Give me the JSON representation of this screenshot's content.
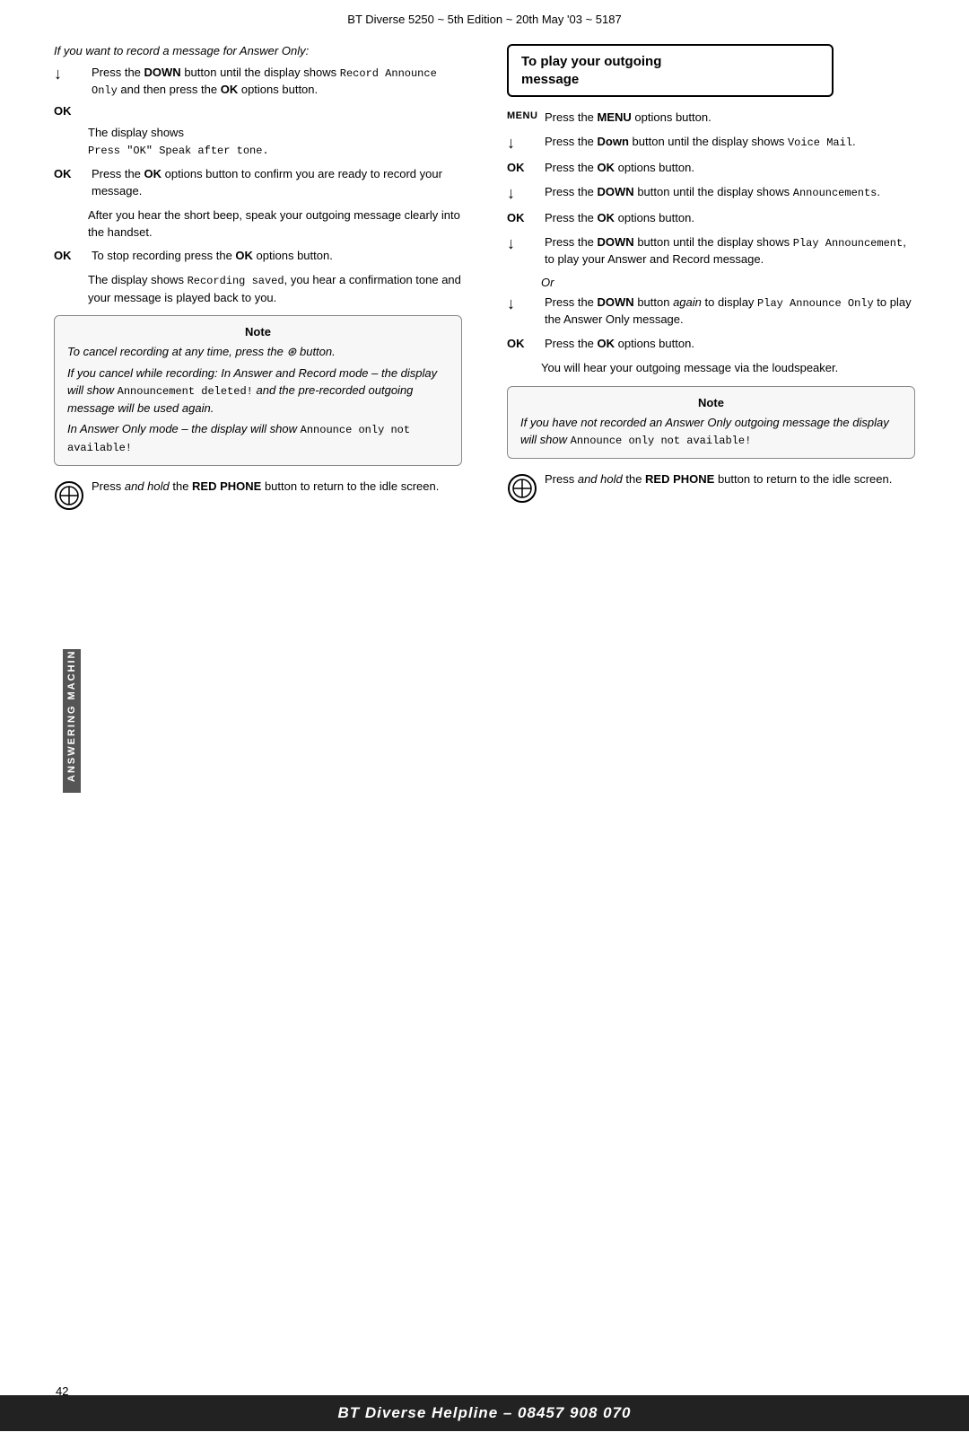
{
  "header": {
    "title": "BT Diverse 5250 ~ 5th Edition ~ 20th May '03 ~ 5187"
  },
  "side_label": "ANSWERING MACHINE",
  "page_number": "42",
  "footer": {
    "text": "BT Diverse Helpline – 08457 908 070"
  },
  "left_col": {
    "italic_heading": "If you want to record a message for Answer Only:",
    "instructions": [
      {
        "label": "↓",
        "type": "arrow",
        "text_parts": [
          {
            "type": "plain",
            "text": "Press the "
          },
          {
            "type": "bold",
            "text": "DOWN"
          },
          {
            "type": "plain",
            "text": " button until the display shows "
          },
          {
            "type": "mono",
            "text": "Record Announce Only"
          },
          {
            "type": "plain",
            "text": " and then press the "
          },
          {
            "type": "bold",
            "text": "OK"
          },
          {
            "type": "plain",
            "text": " options button."
          }
        ]
      },
      {
        "label": "OK",
        "type": "ok",
        "text_parts": []
      },
      {
        "label": "",
        "type": "plain",
        "text": "The display shows"
      },
      {
        "label": "",
        "type": "mono_line",
        "text": "Press \"OK\" Speak after tone."
      },
      {
        "label": "OK",
        "type": "ok",
        "text_parts": [
          {
            "type": "plain",
            "text": "Press the "
          },
          {
            "type": "bold",
            "text": "OK"
          },
          {
            "type": "plain",
            "text": " options button to confirm you are ready to record your message."
          }
        ]
      },
      {
        "label": "",
        "type": "plain",
        "text": "After you hear the short beep, speak your outgoing message clearly into the handset."
      },
      {
        "label": "OK",
        "type": "ok",
        "text_parts": [
          {
            "type": "plain",
            "text": "To stop recording press the "
          },
          {
            "type": "bold",
            "text": "OK"
          },
          {
            "type": "plain",
            "text": " options button."
          }
        ]
      },
      {
        "label": "",
        "type": "plain",
        "text_parts": [
          {
            "type": "plain",
            "text": "The display shows "
          },
          {
            "type": "mono",
            "text": "Recording saved"
          },
          {
            "type": "plain",
            "text": ", you hear a confirmation tone and your message is played back to you."
          }
        ]
      }
    ],
    "note_box": {
      "title": "Note",
      "paragraphs": [
        {
          "italic": true,
          "text": "To cancel recording at any time, press the ⊛ button."
        },
        {
          "italic": true,
          "text": "If you cancel while recording: In Answer and Record mode – the display will show"
        },
        {
          "mono": true,
          "text": "Announcement deleted!"
        },
        {
          "italic": true,
          "text": "and the pre-recorded outgoing message will be used again."
        },
        {
          "italic": true,
          "text": "In Answer Only mode – the display will show"
        },
        {
          "mono": true,
          "text": "Announce only not available!"
        }
      ]
    },
    "bottom_instruction": {
      "text_parts": [
        {
          "type": "plain",
          "text": "Press "
        },
        {
          "type": "italic",
          "text": "and hold"
        },
        {
          "type": "plain",
          "text": " the "
        },
        {
          "type": "bold",
          "text": "RED PHONE"
        },
        {
          "type": "plain",
          "text": " button to return to the idle screen."
        }
      ]
    }
  },
  "right_col": {
    "heading_box": {
      "line1": "To play your outgoing",
      "line2": "message"
    },
    "instructions": [
      {
        "label": "MENU",
        "type": "menu",
        "text_parts": [
          {
            "type": "plain",
            "text": "Press the "
          },
          {
            "type": "bold",
            "text": "MENU"
          },
          {
            "type": "plain",
            "text": " options button."
          }
        ]
      },
      {
        "label": "↓",
        "type": "arrow",
        "text_parts": [
          {
            "type": "plain",
            "text": "Press the "
          },
          {
            "type": "bold",
            "text": "Down"
          },
          {
            "type": "plain",
            "text": " button until the display shows "
          },
          {
            "type": "mono",
            "text": "Voice Mail"
          },
          {
            "type": "plain",
            "text": "."
          }
        ]
      },
      {
        "label": "OK",
        "type": "ok",
        "text_parts": [
          {
            "type": "plain",
            "text": "Press the "
          },
          {
            "type": "bold",
            "text": "OK"
          },
          {
            "type": "plain",
            "text": " options button."
          }
        ]
      },
      {
        "label": "↓",
        "type": "arrow",
        "text_parts": [
          {
            "type": "plain",
            "text": "Press the "
          },
          {
            "type": "bold",
            "text": "DOWN"
          },
          {
            "type": "plain",
            "text": " button until the display shows "
          },
          {
            "type": "mono",
            "text": "Announcements"
          },
          {
            "type": "plain",
            "text": "."
          }
        ]
      },
      {
        "label": "OK",
        "type": "ok",
        "text_parts": [
          {
            "type": "plain",
            "text": "Press the "
          },
          {
            "type": "bold",
            "text": "OK"
          },
          {
            "type": "plain",
            "text": " options button."
          }
        ]
      },
      {
        "label": "↓",
        "type": "arrow",
        "text_parts": [
          {
            "type": "plain",
            "text": "Press the "
          },
          {
            "type": "bold",
            "text": "DOWN"
          },
          {
            "type": "plain",
            "text": " button until the display shows "
          },
          {
            "type": "mono",
            "text": "Play Announcement"
          },
          {
            "type": "plain",
            "text": ", to play your Answer and Record message."
          }
        ]
      },
      {
        "type": "or"
      },
      {
        "label": "↓",
        "type": "arrow",
        "text_parts": [
          {
            "type": "plain",
            "text": "Press the "
          },
          {
            "type": "bold",
            "text": "DOWN"
          },
          {
            "type": "plain",
            "text": " button "
          },
          {
            "type": "italic",
            "text": "again"
          },
          {
            "type": "plain",
            "text": " to display "
          },
          {
            "type": "mono",
            "text": "Play Announce Only"
          },
          {
            "type": "plain",
            "text": " to play the Answer Only message."
          }
        ]
      },
      {
        "label": "OK",
        "type": "ok",
        "text_parts": [
          {
            "type": "plain",
            "text": "Press the "
          },
          {
            "type": "bold",
            "text": "OK"
          },
          {
            "type": "plain",
            "text": " options button."
          }
        ]
      },
      {
        "label": "",
        "type": "plain",
        "text": "You will hear your outgoing message via the loudspeaker."
      }
    ],
    "note_box": {
      "title": "Note",
      "paragraphs": [
        {
          "italic": true,
          "text": "If you have not recorded an Answer Only outgoing message the display will show"
        },
        {
          "mixed": true,
          "italic_text": "show ",
          "mono_text": "Announce only not available!"
        }
      ]
    },
    "bottom_instruction": {
      "text_parts": [
        {
          "type": "plain",
          "text": "Press "
        },
        {
          "type": "italic",
          "text": "and hold"
        },
        {
          "type": "plain",
          "text": " the "
        },
        {
          "type": "bold",
          "text": "RED PHONE"
        },
        {
          "type": "plain",
          "text": " button to return to the idle screen."
        }
      ]
    }
  }
}
